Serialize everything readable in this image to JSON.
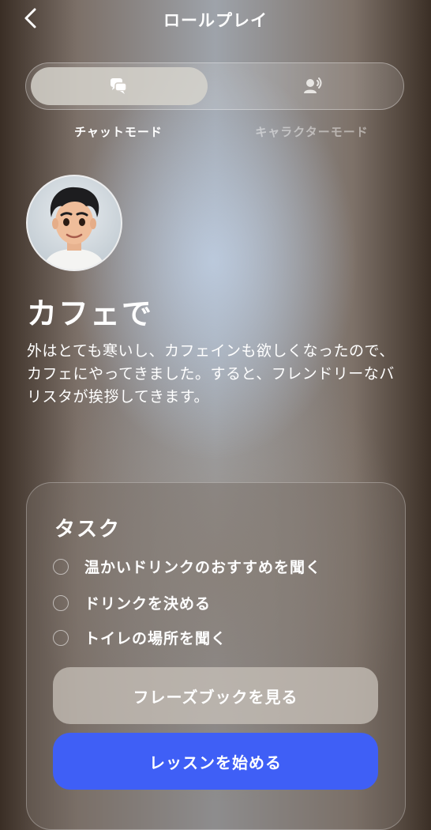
{
  "header": {
    "title": "ロールプレイ"
  },
  "modes": [
    {
      "label": "チャットモード",
      "icon": "chat-bubbles-icon",
      "selected": true
    },
    {
      "label": "キャラクターモード",
      "icon": "speaking-person-icon",
      "selected": false
    }
  ],
  "scene": {
    "title": "カフェで",
    "description": "外はとても寒いし、カフェインも欲しくなったので、カフェにやってきました。すると、フレンドリーなバリスタが挨拶してきます。"
  },
  "tasks": {
    "title": "タスク",
    "items": [
      {
        "label": "温かいドリンクのおすすめを聞く",
        "done": false
      },
      {
        "label": "ドリンクを決める",
        "done": false
      },
      {
        "label": "トイレの場所を聞く",
        "done": false
      }
    ]
  },
  "buttons": {
    "phrasebook": "フレーズブックを見る",
    "start": "レッスンを始める"
  },
  "colors": {
    "accent": "#3f5ff6"
  }
}
